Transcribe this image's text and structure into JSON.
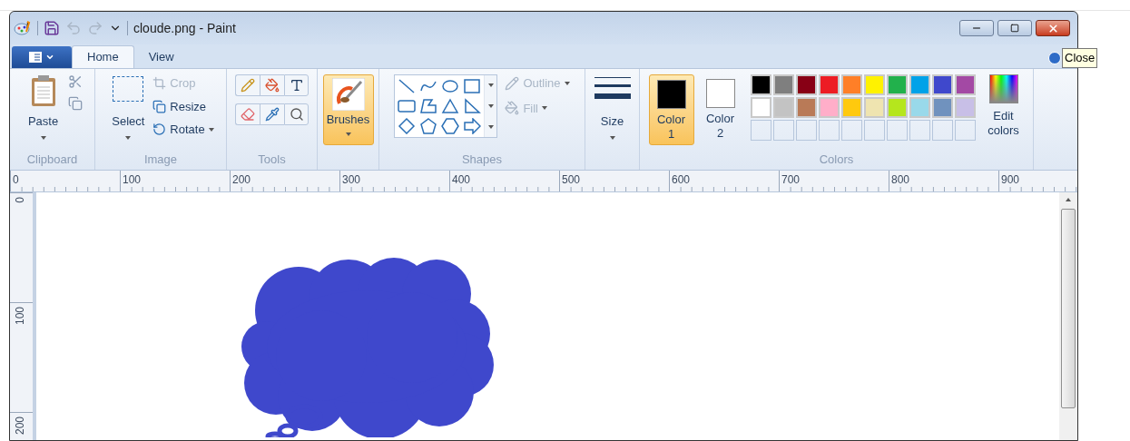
{
  "window": {
    "title": "cloude.png - Paint"
  },
  "tabs": [
    {
      "label": "Home",
      "selected": true
    },
    {
      "label": "View",
      "selected": false
    }
  ],
  "tooltip": "Close",
  "ribbon": {
    "clipboard": {
      "label": "Clipboard",
      "paste": "Paste"
    },
    "image": {
      "label": "Image",
      "select": "Select",
      "tools": [
        {
          "label": "Crop",
          "kind": "crop",
          "disabled": true
        },
        {
          "label": "Resize",
          "kind": "resize",
          "disabled": false
        },
        {
          "label": "Rotate",
          "kind": "rotate",
          "disabled": false
        }
      ]
    },
    "tools": {
      "label": "Tools"
    },
    "brushes": {
      "label": "Brushes",
      "selected": true
    },
    "shapes": {
      "label": "Shapes",
      "options": [
        {
          "label": "Outline",
          "kind": "outline",
          "disabled": true
        },
        {
          "label": "Fill",
          "kind": "fill",
          "disabled": true
        }
      ]
    },
    "size": {
      "label": "Size"
    },
    "colors": {
      "label": "Colors",
      "edit": "Edit colors",
      "slots": [
        {
          "label": "Color",
          "number": "1",
          "color": "#000000",
          "selected": true
        },
        {
          "label": "Color",
          "number": "2",
          "color": "#ffffff",
          "selected": false
        }
      ],
      "palette": [
        {
          "color": "#000000"
        },
        {
          "color": "#7f7f7f"
        },
        {
          "color": "#880015"
        },
        {
          "color": "#ed1c24"
        },
        {
          "color": "#ff7f27"
        },
        {
          "color": "#fff200"
        },
        {
          "color": "#22b14c"
        },
        {
          "color": "#00a2e8"
        },
        {
          "color": "#3f48cc"
        },
        {
          "color": "#a349a4"
        },
        {
          "color": "#ffffff"
        },
        {
          "color": "#c3c3c3"
        },
        {
          "color": "#b97a57"
        },
        {
          "color": "#ffaec9"
        },
        {
          "color": "#ffc90e"
        },
        {
          "color": "#efe4b0"
        },
        {
          "color": "#b5e61d"
        },
        {
          "color": "#99d9ea"
        },
        {
          "color": "#7092be"
        },
        {
          "color": "#c8bfe7"
        }
      ]
    }
  },
  "ruler": {
    "horizontal": [
      "0",
      "100",
      "200",
      "300",
      "400",
      "500",
      "600",
      "700",
      "800",
      "900"
    ],
    "vertical": [
      "0",
      "100",
      "200"
    ]
  }
}
